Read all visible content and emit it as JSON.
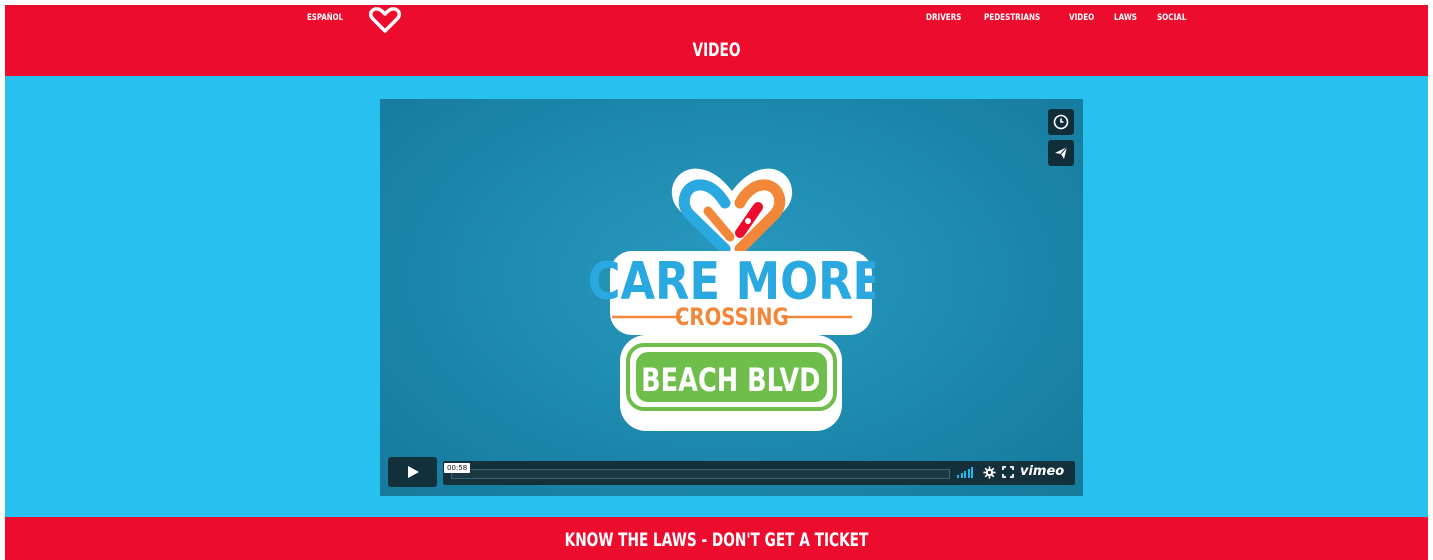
{
  "header": {
    "language_link": "ESPAÑOL",
    "logo_icon": "heart-knot-logo-icon",
    "nav": [
      "DRIVERS",
      "PEDESTRIANS",
      "VIDEO",
      "LAWS",
      "SOCIAL"
    ],
    "page_title": "VIDEO"
  },
  "video": {
    "badge": {
      "line1": "CARE MORE",
      "line2": "CROSSING",
      "line3": "BEACH BLVD"
    },
    "side_buttons": [
      "clock-icon",
      "paper-plane-icon"
    ],
    "controls": {
      "play_icon": "play-icon",
      "time_tooltip": "00:58",
      "progress": 0,
      "brand": "vimeo"
    }
  },
  "footer": {
    "banner": "KNOW THE LAWS - DON'T GET A TICKET"
  },
  "colors": {
    "brand_red": "#ec0d2e",
    "sky_blue": "#28c1ef",
    "orange": "#f2873a",
    "green": "#6fbd4b"
  }
}
